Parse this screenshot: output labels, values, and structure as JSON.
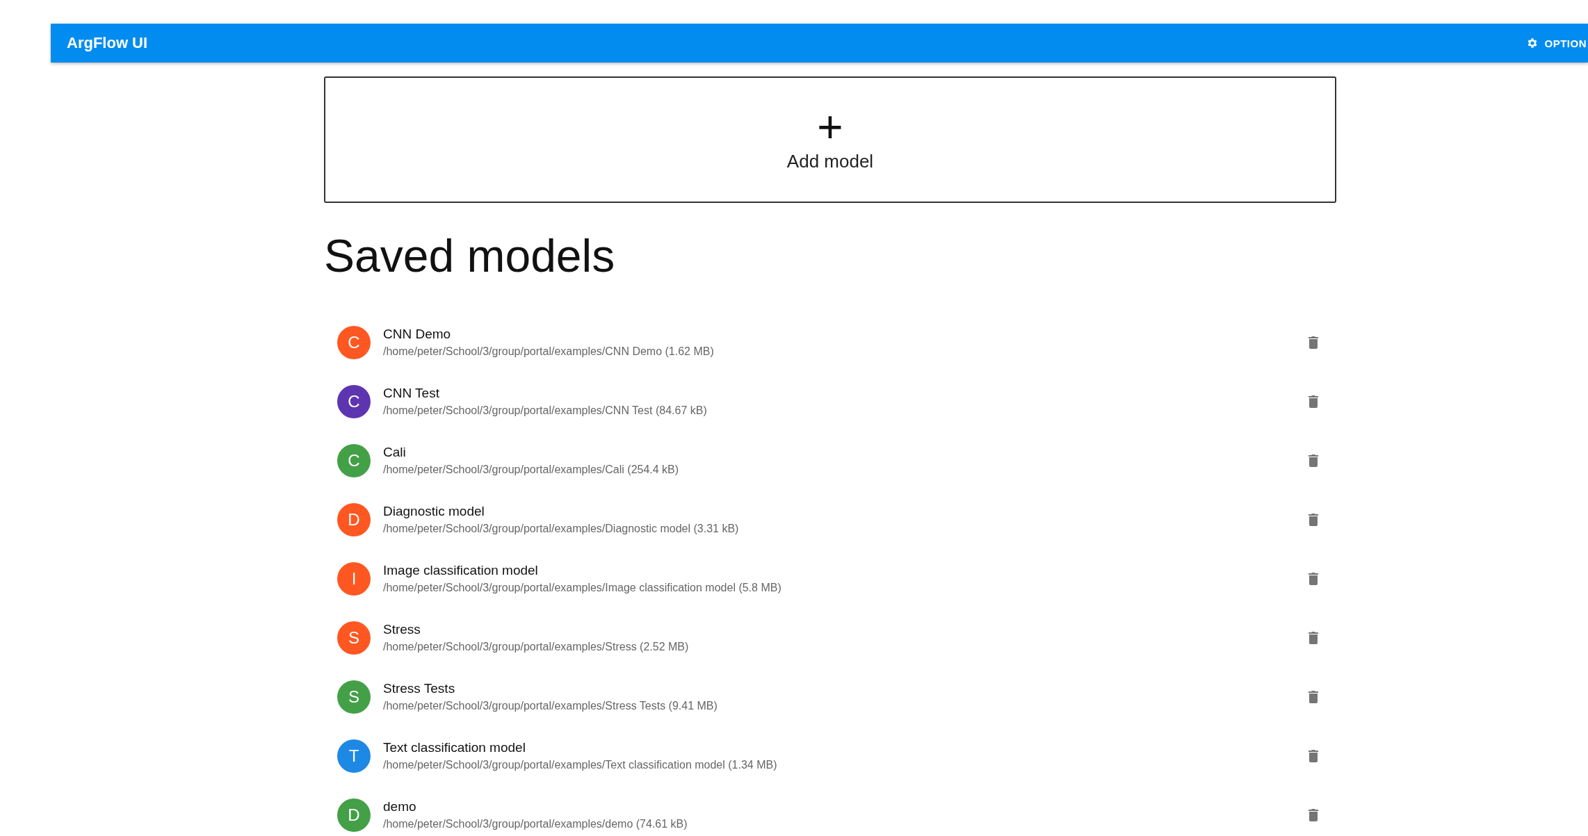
{
  "app_bar": {
    "title": "ArgFlow UI",
    "options_label": "OPTION"
  },
  "add_model": {
    "icon": "+",
    "label": "Add model"
  },
  "heading": "Saved models",
  "models": [
    {
      "initial": "C",
      "color": "#ff5722",
      "name": "CNN Demo",
      "path": "/home/peter/School/3/group/portal/examples/CNN Demo (1.62 MB)"
    },
    {
      "initial": "C",
      "color": "#5e35b1",
      "name": "CNN Test",
      "path": "/home/peter/School/3/group/portal/examples/CNN Test (84.67 kB)"
    },
    {
      "initial": "C",
      "color": "#43a047",
      "name": "Cali",
      "path": "/home/peter/School/3/group/portal/examples/Cali (254.4 kB)"
    },
    {
      "initial": "D",
      "color": "#ff5722",
      "name": "Diagnostic model",
      "path": "/home/peter/School/3/group/portal/examples/Diagnostic model (3.31 kB)"
    },
    {
      "initial": "I",
      "color": "#ff5722",
      "name": "Image classification model",
      "path": "/home/peter/School/3/group/portal/examples/Image classification model (5.8 MB)"
    },
    {
      "initial": "S",
      "color": "#ff5722",
      "name": "Stress",
      "path": "/home/peter/School/3/group/portal/examples/Stress (2.52 MB)"
    },
    {
      "initial": "S",
      "color": "#43a047",
      "name": "Stress Tests",
      "path": "/home/peter/School/3/group/portal/examples/Stress Tests (9.41 MB)"
    },
    {
      "initial": "T",
      "color": "#1e88e5",
      "name": "Text classification model",
      "path": "/home/peter/School/3/group/portal/examples/Text classification model (1.34 MB)"
    },
    {
      "initial": "D",
      "color": "#43a047",
      "name": "demo",
      "path": "/home/peter/School/3/group/portal/examples/demo (74.61 kB)"
    }
  ]
}
